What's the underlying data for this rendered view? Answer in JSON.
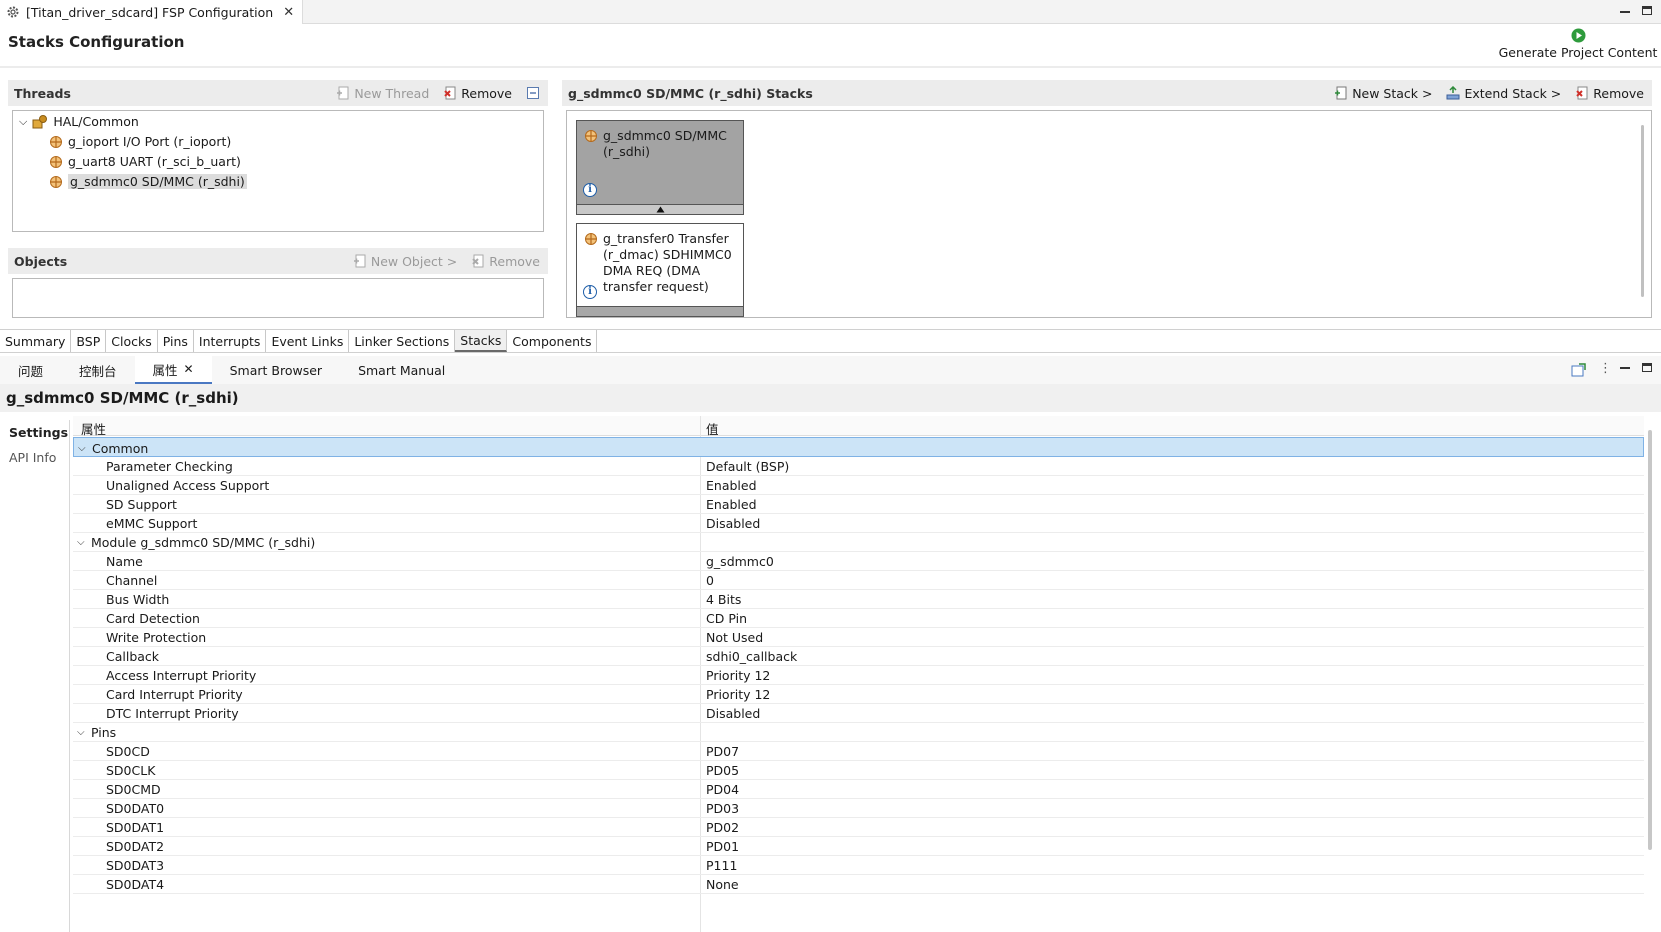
{
  "editor": {
    "tab_title": "[Titan_driver_sdcard] FSP Configuration",
    "page_title": "Stacks Configuration",
    "generate_label": "Generate Project Content"
  },
  "threads": {
    "title": "Threads",
    "new_thread": "New Thread",
    "remove": "Remove",
    "tree": {
      "root": "HAL/Common",
      "items": [
        "g_ioport I/O Port (r_ioport)",
        "g_uart8 UART (r_sci_b_uart)",
        "g_sdmmc0 SD/MMC (r_sdhi)"
      ]
    }
  },
  "objects": {
    "title": "Objects",
    "new_object": "New Object >",
    "remove": "Remove"
  },
  "stacks": {
    "title": "g_sdmmc0 SD/MMC (r_sdhi) Stacks",
    "new_stack": "New Stack >",
    "extend_stack": "Extend Stack >",
    "remove": "Remove",
    "boxes": [
      {
        "lines": [
          "g_sdmmc0 SD/MMC",
          "(r_sdhi)"
        ]
      },
      {
        "lines": [
          "g_transfer0 Transfer",
          "(r_dmac) SDHIMMC0",
          "DMA REQ (DMA",
          "transfer request)"
        ]
      }
    ]
  },
  "config_tabs": [
    "Summary",
    "BSP",
    "Clocks",
    "Pins",
    "Interrupts",
    "Event Links",
    "Linker Sections",
    "Stacks",
    "Components"
  ],
  "view_tabs": [
    "问题",
    "控制台",
    "属性",
    "Smart Browser",
    "Smart Manual"
  ],
  "properties": {
    "title": "g_sdmmc0 SD/MMC (r_sdhi)",
    "side_tabs": [
      "Settings",
      "API Info"
    ],
    "col_property": "属性",
    "col_value": "值",
    "groups": [
      {
        "name": "Common",
        "rows": [
          [
            "Parameter Checking",
            "Default (BSP)"
          ],
          [
            "Unaligned Access Support",
            "Enabled"
          ],
          [
            "SD Support",
            "Enabled"
          ],
          [
            "eMMC Support",
            "Disabled"
          ]
        ]
      },
      {
        "name": "Module g_sdmmc0 SD/MMC (r_sdhi)",
        "rows": [
          [
            "Name",
            "g_sdmmc0"
          ],
          [
            "Channel",
            "0"
          ],
          [
            "Bus Width",
            "4 Bits"
          ],
          [
            "Card Detection",
            "CD Pin"
          ],
          [
            "Write Protection",
            "Not Used"
          ],
          [
            "Callback",
            "sdhi0_callback"
          ],
          [
            "Access Interrupt Priority",
            "Priority 12"
          ],
          [
            "Card Interrupt Priority",
            "Priority 12"
          ],
          [
            "DTC Interrupt Priority",
            "Disabled"
          ]
        ]
      },
      {
        "name": "Pins",
        "rows": [
          [
            "SD0CD",
            "PD07"
          ],
          [
            "SD0CLK",
            "PD05"
          ],
          [
            "SD0CMD",
            "PD04"
          ],
          [
            "SD0DAT0",
            "PD03"
          ],
          [
            "SD0DAT1",
            "PD02"
          ],
          [
            "SD0DAT2",
            "PD01"
          ],
          [
            "SD0DAT3",
            "P111"
          ],
          [
            "SD0DAT4",
            "None"
          ]
        ]
      }
    ]
  }
}
